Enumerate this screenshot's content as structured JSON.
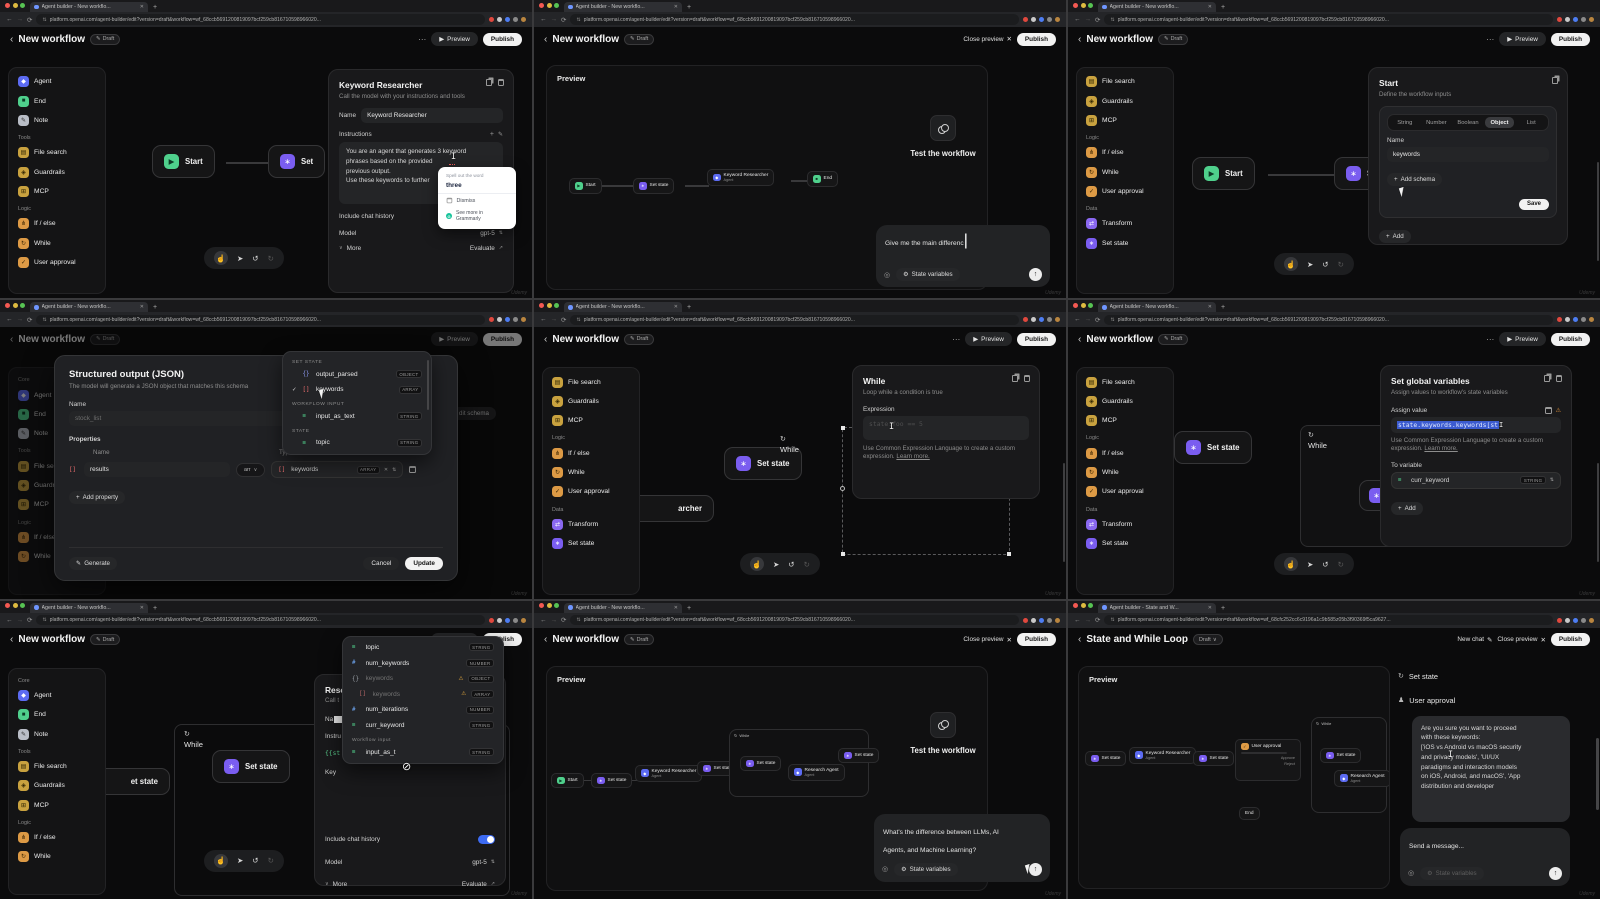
{
  "glyphs": {
    "back": "‹",
    "dots": "⋯",
    "play": "▶",
    "close": "✕",
    "caret": "∨",
    "up_arrow": "↑",
    "undo": "↺",
    "redo": "↻",
    "hand": "☝",
    "pointer": "➤",
    "plus": "+",
    "pencil": "✎",
    "external": "↗",
    "check": "✓",
    "warn": "⚠",
    "loop": "↻",
    "gear": "⚙",
    "attach": "◎",
    "stepper": "⇅",
    "x": "✕",
    "ibeam": "I",
    "blocked": "⊘",
    "person": "♟",
    "tune": "⇅",
    "string": "≡"
  },
  "chrome": {
    "tab_title_new": "Agent builder - New workflo...",
    "tab_title_state": "Agent builder - State and W...",
    "url_new": "platform.openai.com/agent-builder/edit?version=draft&workflow=wf_68ccb5691200819097bcf259cb816710598966020...",
    "url_state": "platform.openai.com/agent-builder/edit?version=draft&workflow=wf_68cfc252cc6c9196a1c9b585z05b3f90369f5ca9627..."
  },
  "common": {
    "title": "New workflow",
    "draft": "Draft",
    "preview": "Preview",
    "publish": "Publish",
    "close_preview": "Close preview",
    "preview_label": "Preview",
    "test_workflow": "Test the workflow",
    "state_variables": "State variables",
    "cel_help": "Use Common Expression Language to create a custom expression.",
    "learn_more": "Learn more.",
    "include_chat_history": "Include chat history",
    "model_label": "Model",
    "model_value": "gpt-5",
    "more": "More",
    "evaluate": "Evaluate",
    "add": "Add",
    "watermark": "Udemy"
  },
  "side_a": [
    {
      "label": "Agent",
      "color": "#5c6bf2",
      "fg": "#ffffff",
      "glyph": "◆"
    },
    {
      "label": "End",
      "color": "#4fd08c",
      "fg": "#0d3b26",
      "glyph": "■"
    },
    {
      "label": "Note",
      "color": "#b9bdc6",
      "fg": "#2a2a2a",
      "glyph": "✎"
    },
    {
      "header": "Tools"
    },
    {
      "label": "File search",
      "color": "#c9a23f",
      "fg": "#2e2300",
      "glyph": "▤"
    },
    {
      "label": "Guardrails",
      "color": "#c9a23f",
      "fg": "#2e2300",
      "glyph": "◈"
    },
    {
      "label": "MCP",
      "color": "#c9a23f",
      "fg": "#2e2300",
      "glyph": "⊞"
    },
    {
      "header": "Logic"
    },
    {
      "label": "If / else",
      "color": "#dd9a45",
      "fg": "#3a2400",
      "glyph": "⋔"
    },
    {
      "label": "While",
      "color": "#dd9a45",
      "fg": "#3a2400",
      "glyph": "↻"
    },
    {
      "label": "User approval",
      "color": "#dd9a45",
      "fg": "#3a2400",
      "glyph": "✓"
    }
  ],
  "side_b": [
    {
      "label": "File search",
      "color": "#c9a23f",
      "fg": "#2e2300",
      "glyph": "▤"
    },
    {
      "label": "Guardrails",
      "color": "#c9a23f",
      "fg": "#2e2300",
      "glyph": "◈"
    },
    {
      "label": "MCP",
      "color": "#c9a23f",
      "fg": "#2e2300",
      "glyph": "⊞"
    },
    {
      "header": "Logic"
    },
    {
      "label": "If / else",
      "color": "#dd9a45",
      "fg": "#3a2400",
      "glyph": "⋔"
    },
    {
      "label": "While",
      "color": "#dd9a45",
      "fg": "#3a2400",
      "glyph": "↻"
    },
    {
      "label": "User approval",
      "color": "#dd9a45",
      "fg": "#3a2400",
      "glyph": "✓"
    },
    {
      "header": "Data"
    },
    {
      "label": "Transform",
      "color": "#8a68f0",
      "fg": "#ffffff",
      "glyph": "⇄"
    },
    {
      "label": "Set state",
      "color": "#7a5df0",
      "fg": "#ffffff",
      "glyph": "∗"
    }
  ],
  "side_c": [
    {
      "header": "Core"
    },
    {
      "label": "Agent",
      "color": "#5c6bf2",
      "fg": "#ffffff",
      "glyph": "◆"
    },
    {
      "label": "End",
      "color": "#4fd08c",
      "fg": "#0d3b26",
      "glyph": "■"
    },
    {
      "label": "Note",
      "color": "#b9bdc6",
      "fg": "#2a2a2a",
      "glyph": "✎"
    },
    {
      "header": "Tools"
    },
    {
      "label": "File search",
      "color": "#c9a23f",
      "fg": "#2e2300",
      "glyph": "▤"
    },
    {
      "label": "Guardrails",
      "color": "#c9a23f",
      "fg": "#2e2300",
      "glyph": "◈"
    },
    {
      "label": "MCP",
      "color": "#c9a23f",
      "fg": "#2e2300",
      "glyph": "⊞"
    },
    {
      "header": "Logic"
    },
    {
      "label": "If / else",
      "color": "#dd9a45",
      "fg": "#3a2400",
      "glyph": "⋔"
    },
    {
      "label": "While",
      "color": "#dd9a45",
      "fg": "#3a2400",
      "glyph": "↻"
    }
  ],
  "p1": {
    "cfg_title": "Keyword Researcher",
    "cfg_sub": "Call the model with your instructions and tools",
    "name_label": "Name",
    "name_value": "Keyword Researcher",
    "instructions_label": "Instructions",
    "instructions": "You are an agent that generates 3 keyword\nphrases based on the provided\nprevious output.\nUse these keywords to further",
    "gram_header": "Spell out the word",
    "gram_suggestion": "three",
    "gram_dismiss": "Dismiss",
    "gram_more": "See more in Grammarly",
    "start": "Start",
    "set": "Set"
  },
  "p2": {
    "chat_draft": "Give me the main differenc",
    "start": "Start",
    "set_state": "Set state",
    "kw": "Keyword Researcher",
    "agent": "Agent",
    "end": "End"
  },
  "p3": {
    "cfg_title": "Start",
    "cfg_sub": "Define the workflow inputs",
    "tabs": [
      {
        "label": "String"
      },
      {
        "label": "Number"
      },
      {
        "label": "Boolean"
      },
      {
        "label": "Object",
        "active": true
      },
      {
        "label": "List"
      }
    ],
    "name_label": "Name",
    "name_value": "keywords",
    "add_schema": "Add schema",
    "save": "Save",
    "start": "Start",
    "set": "Set s"
  },
  "p4": {
    "title": "Structured output (JSON)",
    "sub": "The model will generate a JSON object that matches this schema",
    "name_label": "Name",
    "name_placeholder": "stock_list",
    "properties": "Properties",
    "col_name": "Name",
    "col_type": "Type",
    "row_name": "results",
    "row_type": "arr",
    "val_name": "keywords",
    "val_type": "ARRAY",
    "add_property": "Add property",
    "generate": "Generate",
    "cancel": "Cancel",
    "update": "Update",
    "bg_schema": "dit schema",
    "bg_end": "End",
    "dropdown": [
      {
        "header": "SET STATE"
      },
      {
        "label": "output_parsed",
        "type": "OBJECT",
        "glyph": "{}",
        "fg": "#8f9bf7"
      },
      {
        "label": "keywords",
        "type": "ARRAY",
        "glyph": "[]",
        "fg": "#ef6f6f",
        "check": "✓"
      },
      {
        "header": "WORKFLOW INPUT"
      },
      {
        "label": "input_as_text",
        "type": "STRING",
        "glyph": "≡",
        "fg": "#52d68f"
      },
      {
        "header": "STATE"
      },
      {
        "label": "topic",
        "type": "STRING",
        "glyph": "≡",
        "fg": "#52d68f"
      }
    ]
  },
  "p5": {
    "cfg_title": "While",
    "cfg_sub": "Loop while a condition is true",
    "expression_label": "Expression",
    "expression_placeholder": "state.foo == 5",
    "while": "While",
    "set_state": "Set state",
    "archer": "archer"
  },
  "p6": {
    "cfg_title": "Set global variables",
    "cfg_sub": "Assign values to workflow's state variables",
    "assign_label": "Assign value",
    "assign_value": "state.keywords.keywords[st",
    "to_variable": "To variable",
    "var_name": "curr_keyword",
    "var_type": "STRING",
    "set_state": "Set state",
    "while": "While",
    "s": "S"
  },
  "p7": {
    "bg_title": "Reso",
    "bg_sub": "Call t",
    "bg_name": "Na",
    "bg_instr": "Instru",
    "bg_token": "{{st",
    "bg_key": "Key",
    "while": "While",
    "set_state": "Set state",
    "et_state": "et state",
    "dropdown": [
      {
        "label": "topic",
        "type": "STRING",
        "glyph": "≡",
        "fg": "#52d68f"
      },
      {
        "label": "num_keywords",
        "type": "NUMBER",
        "glyph": "#",
        "fg": "#6fa8f5"
      },
      {
        "label": "keywords",
        "type": "OBJECT",
        "glyph": "{}",
        "fg": "#9aa0a6",
        "dim": true,
        "warn": "⚠"
      },
      {
        "label": "keywords",
        "type": "ARRAY",
        "glyph": "[]",
        "fg": "#b86868",
        "indent": true,
        "warn": "⚠"
      },
      {
        "label": "num_iterations",
        "type": "NUMBER",
        "glyph": "#",
        "fg": "#6fa8f5"
      },
      {
        "label": "curr_keyword",
        "type": "STRING",
        "glyph": "≡",
        "fg": "#52d68f"
      },
      {
        "header": "Workflow input"
      },
      {
        "label": "input_as_t",
        "type": "STRING",
        "glyph": "≡",
        "fg": "#52d68f"
      }
    ]
  },
  "p8": {
    "chat_text": "What's the difference between LLMs, AI\nAgents, and Machine Learning?",
    "start": "Start",
    "set_state": "Set state",
    "kw": "Keyword Researcher",
    "agent": "Agent",
    "research": "Research Agent",
    "while": "While"
  },
  "p9": {
    "title": "State and While Loop",
    "draft": "Draft",
    "new_chat": "New chat",
    "status_set_state": "Set state",
    "status_user_approval": "User approval",
    "message": "Are you sure you want to proceed\nwith these keywords:\n['iOS vs Android vs macOS security\nand privacy models', 'UI/UX\nparadigms and interaction models\non iOS, Android, and macOS', 'App\ndistribution and developer",
    "input_placeholder": "Send a message...",
    "set_state": "Set state",
    "kw": "Keyword Researcher",
    "agent": "Agent",
    "user_approval": "User approval",
    "approve": "Approve",
    "reject": "Reject",
    "research": "Research Agent",
    "end": "End",
    "while": "While"
  }
}
